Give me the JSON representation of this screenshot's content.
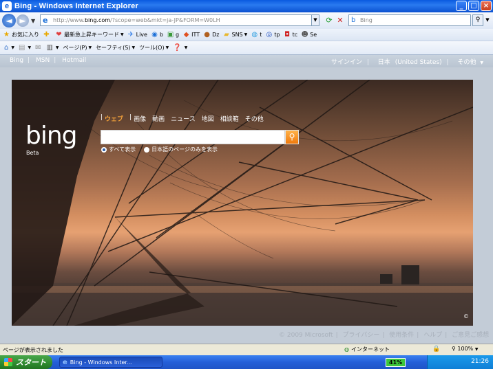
{
  "window": {
    "title": "Bing - Windows Internet Explorer",
    "controls": {
      "minimize": "_",
      "maximize": "□",
      "close": "×"
    }
  },
  "address": {
    "url_prefix": "http://www.",
    "url_host": "bing.com",
    "url_rest": "/?scope=web&mkt=ja-JP&FORM=W0LH",
    "search_placeholder": "Bing"
  },
  "favorites": {
    "label": "お気に入り",
    "items": [
      {
        "icon": "star-icon",
        "label": "最新急上昇キーワード"
      },
      {
        "icon": "live-icon",
        "label": "Live"
      },
      {
        "icon": "b-icon",
        "label": "b"
      },
      {
        "icon": "g-icon",
        "label": "g"
      },
      {
        "icon": "itt-icon",
        "label": "ITT"
      },
      {
        "icon": "dz-icon",
        "label": "Dz"
      },
      {
        "icon": "folder-icon",
        "label": "SNS"
      },
      {
        "icon": "t-icon",
        "label": "t"
      },
      {
        "icon": "tp-icon",
        "label": "tp"
      },
      {
        "icon": "tc-icon",
        "label": "tc"
      },
      {
        "icon": "se-icon",
        "label": "Se"
      }
    ]
  },
  "commands": {
    "page": "ページ(P)",
    "safety": "セーフティ(S)",
    "tools": "ツール(O)"
  },
  "bing": {
    "nav_left": [
      "Bing",
      "MSN",
      "Hotmail"
    ],
    "nav_right": [
      "サインイン",
      "日本",
      "(United States)",
      "その他"
    ],
    "logo": "bing",
    "beta": "Beta",
    "scopes": [
      "ウェブ",
      "画像",
      "動画",
      "ニュース",
      "地図",
      "相談箱",
      "その他"
    ],
    "radio_all": "すべて表示",
    "radio_japanese": "日本語のページのみを表示",
    "footer": [
      "© 2009 Microsoft",
      "プライバシー",
      "使用条件",
      "ヘルプ",
      "ご意見ご感想"
    ]
  },
  "status": {
    "message": "ページが表示されました",
    "zone": "インターネット",
    "zoom": "100%"
  },
  "taskbar": {
    "start": "スタート",
    "task": "Bing - Windows Inter...",
    "battery": "41%",
    "clock": "21:26"
  }
}
